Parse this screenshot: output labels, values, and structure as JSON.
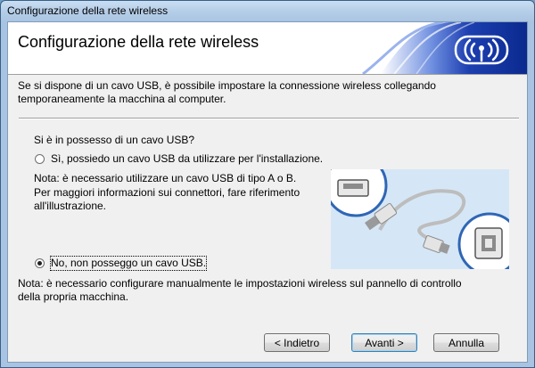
{
  "window": {
    "title": "Configurazione della rete wireless"
  },
  "header": {
    "title": "Configurazione della rete wireless",
    "banner_icon": "wireless-signal-icon"
  },
  "intro": {
    "line1": "Se si dispone di un cavo USB, è possibile impostare la connessione wireless collegando",
    "line2": "temporaneamente la macchina al computer."
  },
  "question": "Si è in possesso di un cavo USB?",
  "options": [
    {
      "label": "Sì, possiedo un cavo USB da utilizzare per l'installazione.",
      "selected": false,
      "note": [
        "Nota: è necessario utilizzare un cavo USB di tipo A o B.",
        "Per maggiori informazioni sui connettori, fare riferimento",
        "all'illustrazione."
      ]
    },
    {
      "label": "No, non posseggo un cavo USB.",
      "selected": true,
      "note": [
        "Nota: è necessario configurare manualmente le impostazioni wireless sul pannello di controllo",
        "della propria macchina."
      ]
    }
  ],
  "buttons": {
    "back": "< Indietro",
    "next": "Avanti >",
    "cancel": "Annulla"
  },
  "colors": {
    "banner_blue": "#1d3fb0",
    "illustration_bg": "#d5e7f6"
  }
}
